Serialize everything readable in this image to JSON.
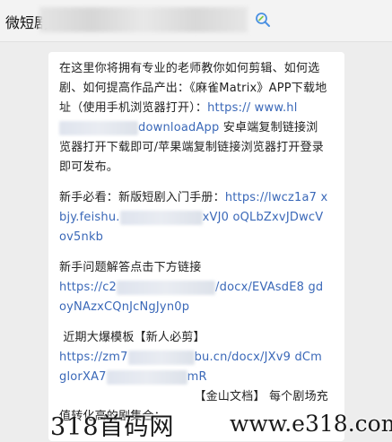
{
  "header": {
    "title": "微短剧"
  },
  "message": {
    "intro": "在这里你将拥有专业的老师教你如何剪辑、如何选剧、如何提高作品产出：《麻雀Matrix》APP下载地址（使用手机浏览器打开）：",
    "app_link_a": "https://",
    "app_link_b": "www.hl",
    "app_link_c": "downloadApp",
    "app_tail": "安卓端复制链接浏览器打开下载即可/苹果端复制链接浏览器打开登录即可发布。",
    "newbie_label": "新手必看：新版短剧入门手册：",
    "newbie_link_a": "https://lwcz1a7",
    "newbie_link_b": "xbjy.feishu.",
    "newbie_link_c": "xVJ0",
    "newbie_link_d": "oQLbZxvJDwcVov5nkb",
    "faq_label": "新手问题解答点击下方链接",
    "faq_link_a": "https://c2",
    "faq_link_b": "/docx/EVAsdE8",
    "faq_link_c": "gdoyNAzxCQnJcNgJyn0p",
    "template_label": "近期大爆模板【新人必剪】",
    "template_link_a": "https://zm7",
    "template_link_b": "bu.cn/docx/JXv9",
    "template_link_c": "dCmglorXA7",
    "template_link_d": "mR",
    "jinshan_label": "【金山文档】 每个剧场充",
    "conversion_label": "值转化高的剧集合："
  },
  "watermark": {
    "left": "318首码网",
    "right": "www.e318.com"
  }
}
